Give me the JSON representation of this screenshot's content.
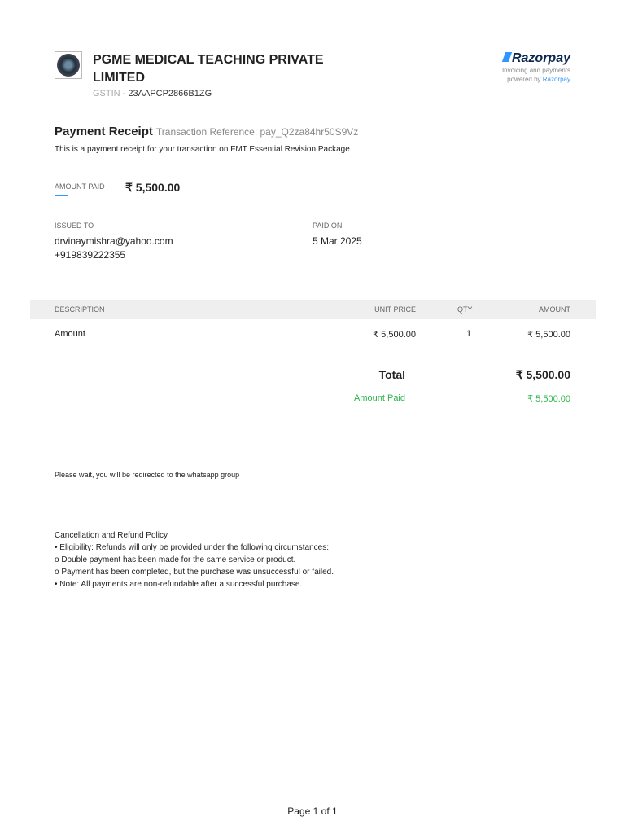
{
  "company": {
    "name": "PGME MEDICAL TEACHING PRIVATE LIMITED",
    "gstin_label": "GSTIN -",
    "gstin": "23AAPCP2866B1ZG"
  },
  "razorpay": {
    "brand": "Razorpay",
    "line1": "Invoicing and payments",
    "line2": "powered by",
    "link": "Razorpay"
  },
  "receipt": {
    "title": "Payment Receipt",
    "ref": "Transaction Reference: pay_Q2za84hr50S9Vz",
    "desc": "This is a payment receipt for your transaction on FMT Essential Revision Package",
    "amount_label": "AMOUNT PAID",
    "amount": "₹ 5,500.00"
  },
  "issued": {
    "label": "ISSUED TO",
    "email": "drvinaymishra@yahoo.com",
    "phone": "+919839222355"
  },
  "paid": {
    "label": "PAID ON",
    "date": "5 Mar 2025"
  },
  "table": {
    "headers": [
      "DESCRIPTION",
      "UNIT PRICE",
      "QTY",
      "AMOUNT"
    ],
    "row": [
      "Amount",
      "₹ 5,500.00",
      "1",
      "₹ 5,500.00"
    ],
    "total_label": "Total",
    "total": "₹ 5,500.00",
    "paid_label": "Amount Paid",
    "paid": "₹ 5,500.00"
  },
  "notice": "Please wait, you will be redirected to the whatsapp group",
  "policy": [
    "Cancellation and Refund Policy",
    "• Eligibility: Refunds will only be provided under the following circumstances:",
    "o Double payment has been made for the same service or product.",
    "o Payment has been completed, but the purchase was unsuccessful or failed.",
    "• Note: All payments are non-refundable after a successful purchase."
  ],
  "page": "Page 1 of 1"
}
